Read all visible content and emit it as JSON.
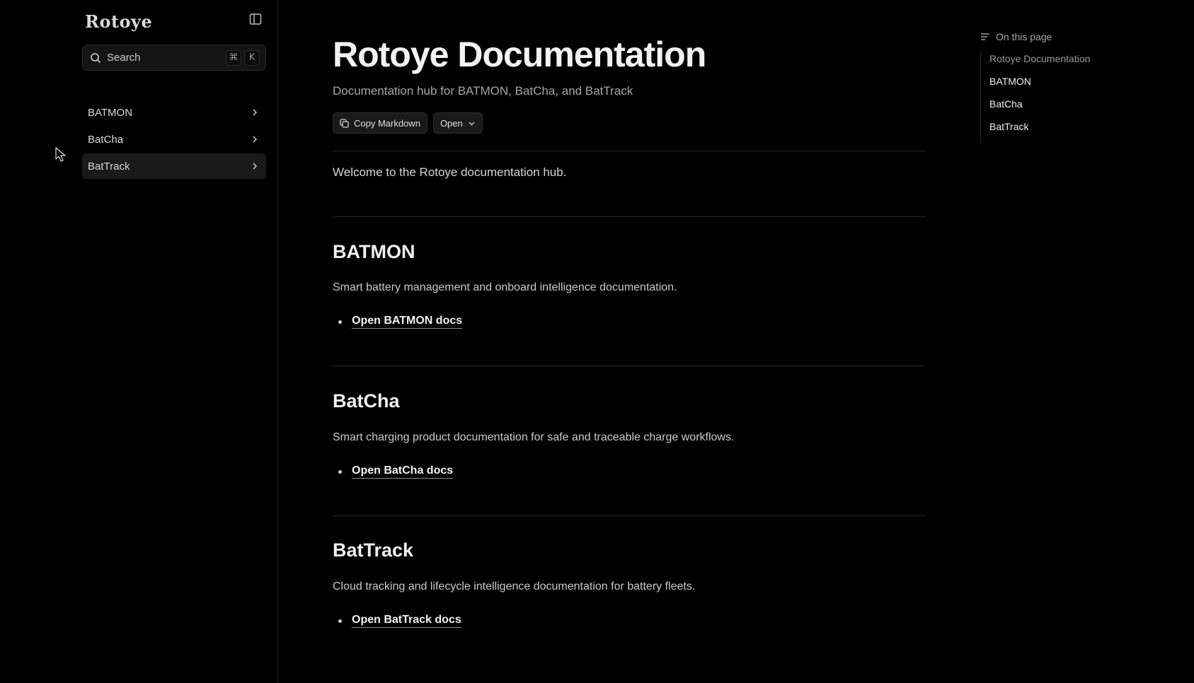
{
  "sidebar": {
    "logo": "Rotoye",
    "search": {
      "label": "Search",
      "shortcut_mod": "⌘",
      "shortcut_key": "K"
    },
    "items": [
      {
        "label": "BATMON"
      },
      {
        "label": "BatCha"
      },
      {
        "label": "BatTrack"
      }
    ]
  },
  "main": {
    "title": "Rotoye Documentation",
    "subtitle": "Documentation hub for BATMON, BatCha, and BatTrack",
    "actions": {
      "copy_label": "Copy Markdown",
      "open_label": "Open"
    },
    "welcome": "Welcome to the Rotoye documentation hub.",
    "sections": [
      {
        "heading": "BATMON",
        "description": "Smart battery management and onboard intelligence documentation.",
        "link": "Open BATMON docs"
      },
      {
        "heading": "BatCha",
        "description": "Smart charging product documentation for safe and traceable charge workflows.",
        "link": "Open BatCha docs"
      },
      {
        "heading": "BatTrack",
        "description": "Cloud tracking and lifecycle intelligence documentation for battery fleets.",
        "link": "Open BatTrack docs"
      }
    ]
  },
  "toc": {
    "heading": "On this page",
    "links": [
      {
        "label": "Rotoye Documentation"
      },
      {
        "label": "BATMON"
      },
      {
        "label": "BatCha"
      },
      {
        "label": "BatTrack"
      }
    ]
  }
}
